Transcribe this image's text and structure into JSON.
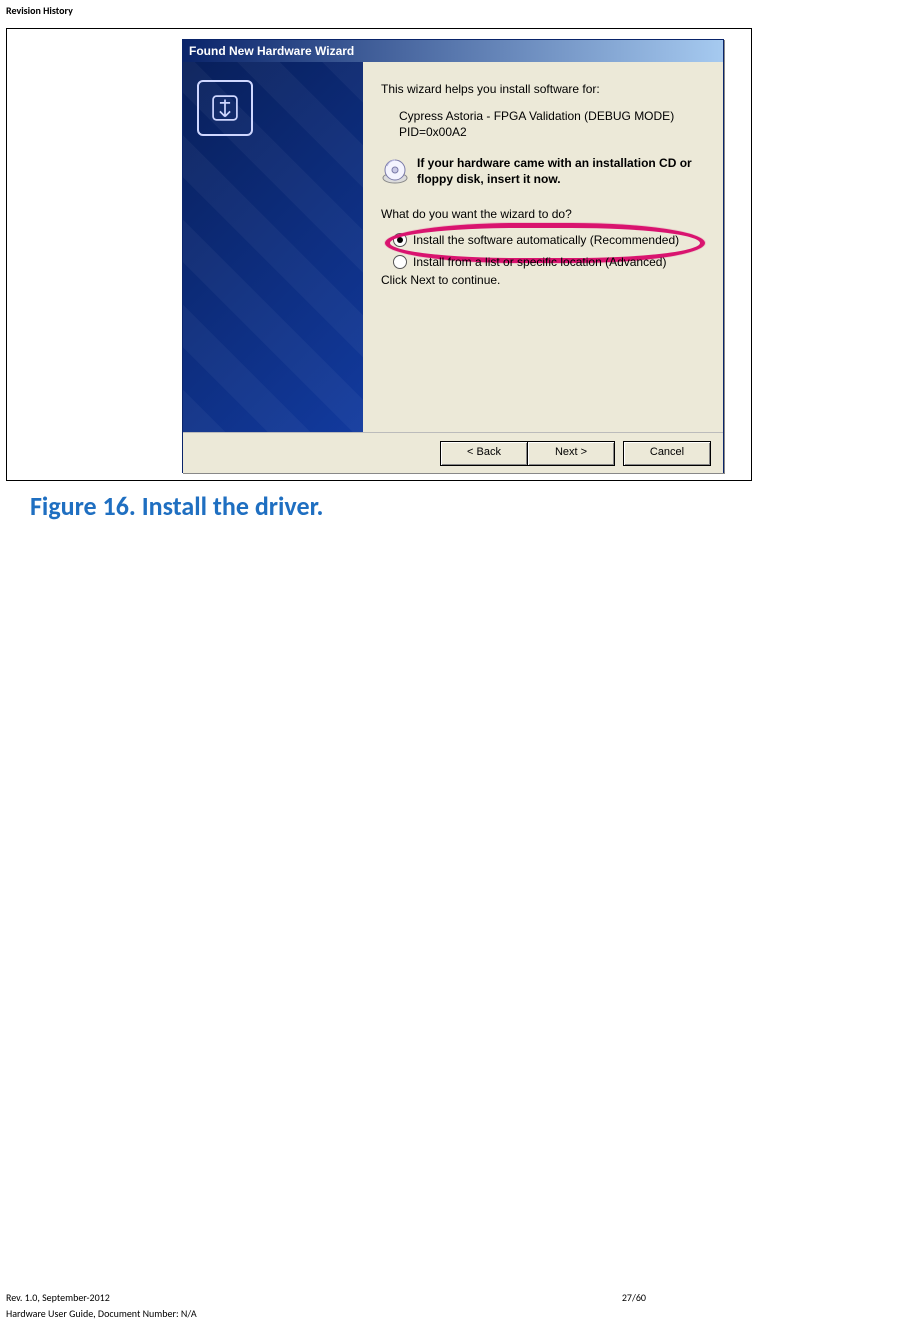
{
  "header": "Revision History",
  "wizard": {
    "title": "Found New Hardware Wizard",
    "intro": "This wizard helps you install software for:",
    "device_line1": "Cypress Astoria - FPGA Validation (DEBUG MODE)",
    "device_line2": "PID=0x00A2",
    "cd_hint": "If your hardware came with an installation CD or floppy disk, insert it now.",
    "prompt": "What do you want the wizard to do?",
    "opt_auto": "Install the software automatically (Recommended)",
    "opt_specific": "Install from a list or specific location (Advanced)",
    "continue": "Click Next to continue.",
    "btn_back": "< Back",
    "btn_next": "Next >",
    "btn_cancel": "Cancel"
  },
  "caption": "Figure 16. Install the driver.",
  "footer": {
    "rev": "Rev. 1.0, September-2012",
    "page": "27/60",
    "doc": "Hardware User Guide, Document Number: N/A"
  }
}
